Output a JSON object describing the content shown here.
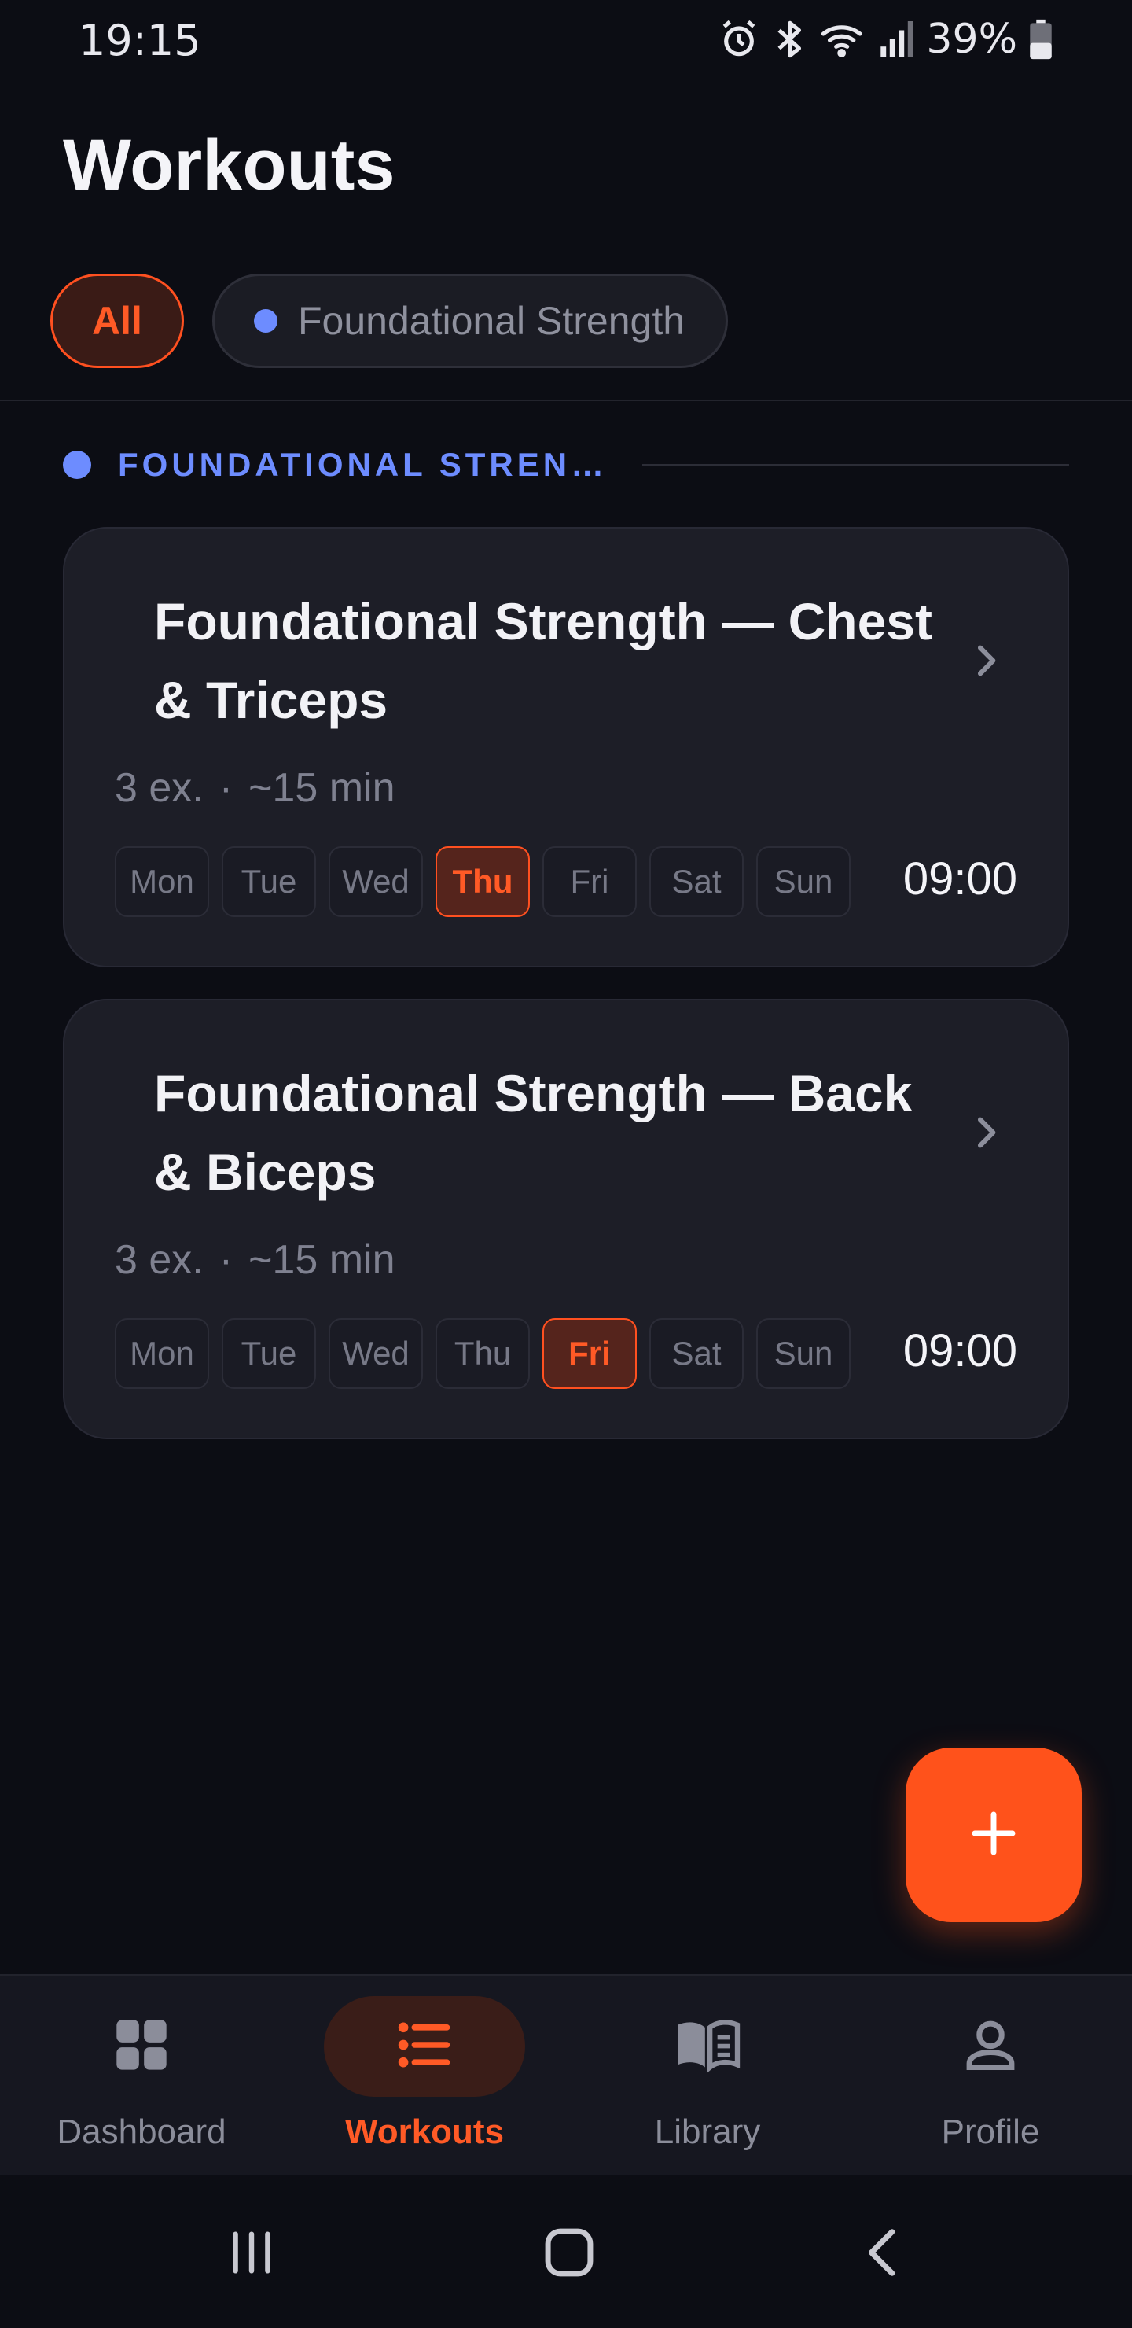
{
  "status_bar": {
    "time": "19:15",
    "battery": "39%",
    "icons": [
      "alarm-icon",
      "bluetooth-icon",
      "wifi-icon",
      "signal-icon",
      "battery-icon"
    ]
  },
  "header": {
    "title": "Workouts"
  },
  "filters": {
    "all_label": "All",
    "plan_label": "Foundational Strength",
    "plan_color": "#6d8cff",
    "active": "All"
  },
  "section": {
    "title": "FOUNDATIONAL STREN…",
    "color": "#6d8cff"
  },
  "workouts": [
    {
      "title": "Foundational Strength — Chest & Triceps",
      "exercises": "3 ex.",
      "separator": "·",
      "duration": "~15 min",
      "days": [
        "Mon",
        "Tue",
        "Wed",
        "Thu",
        "Fri",
        "Sat",
        "Sun"
      ],
      "active_day": "Thu",
      "time": "09:00"
    },
    {
      "title": "Foundational Strength — Back & Biceps",
      "exercises": "3 ex.",
      "separator": "·",
      "duration": "~15 min",
      "days": [
        "Mon",
        "Tue",
        "Wed",
        "Thu",
        "Fri",
        "Sat",
        "Sun"
      ],
      "active_day": "Fri",
      "time": "09:00"
    }
  ],
  "fab": {
    "icon": "plus-icon"
  },
  "bottom_nav": {
    "items": [
      {
        "label": "Dashboard",
        "icon": "grid-icon"
      },
      {
        "label": "Workouts",
        "icon": "list-icon"
      },
      {
        "label": "Library",
        "icon": "book-icon"
      },
      {
        "label": "Profile",
        "icon": "person-icon"
      }
    ],
    "active": "Workouts"
  },
  "colors": {
    "accent": "#ff521b",
    "background": "#0c0d14",
    "card": "#1d1e27",
    "plan": "#6d8cff"
  },
  "system_nav": {
    "icons": [
      "recent-apps-icon",
      "home-icon",
      "back-icon"
    ]
  }
}
